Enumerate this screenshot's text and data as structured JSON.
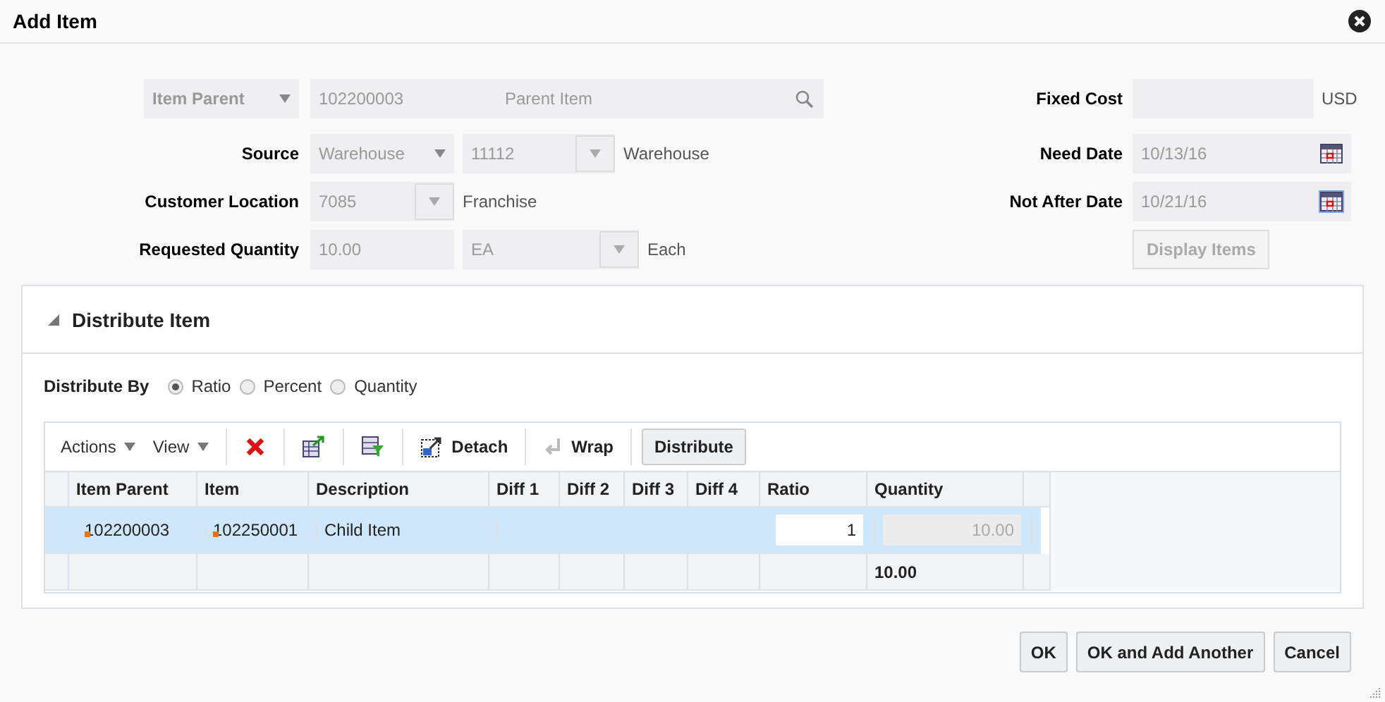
{
  "dialog": {
    "title": "Add Item"
  },
  "item_lookup": {
    "type": "Item Parent",
    "item": "102200003",
    "description": "Parent Item"
  },
  "source": {
    "label": "Source",
    "type": "Warehouse",
    "location": "11112",
    "location_name": "Warehouse"
  },
  "customer_location": {
    "label": "Customer Location",
    "value": "7085",
    "name": "Franchise"
  },
  "requested_quantity": {
    "label": "Requested Quantity",
    "value": "10.00",
    "uom": "EA",
    "uom_name": "Each"
  },
  "fixed_cost": {
    "label": "Fixed Cost",
    "currency": "USD"
  },
  "need_date": {
    "label": "Need Date",
    "value": "10/13/16"
  },
  "not_after_date": {
    "label": "Not After Date",
    "value": "10/21/16"
  },
  "display_items_button": "Display Items",
  "distribute_section": {
    "title": "Distribute Item",
    "distribute_by": {
      "label": "Distribute By",
      "options": [
        {
          "label": "Ratio",
          "selected": true
        },
        {
          "label": "Percent",
          "selected": false
        },
        {
          "label": "Quantity",
          "selected": false
        }
      ]
    },
    "toolbar": {
      "menus": [
        "Actions",
        "View"
      ],
      "detach": "Detach",
      "wrap": "Wrap",
      "distribute": "Distribute"
    },
    "table": {
      "columns": [
        "Item Parent",
        "Item",
        "Description",
        "Diff 1",
        "Diff 2",
        "Diff 3",
        "Diff 4",
        "Ratio",
        "Quantity"
      ],
      "rows": [
        {
          "selected": true,
          "item_parent": "102200003",
          "item": "102250001",
          "description": "Child Item",
          "ratio": "1",
          "quantity": "10.00"
        }
      ],
      "total_quantity": "10.00"
    }
  },
  "buttons": [
    "OK",
    "OK and Add Another",
    "Cancel"
  ]
}
